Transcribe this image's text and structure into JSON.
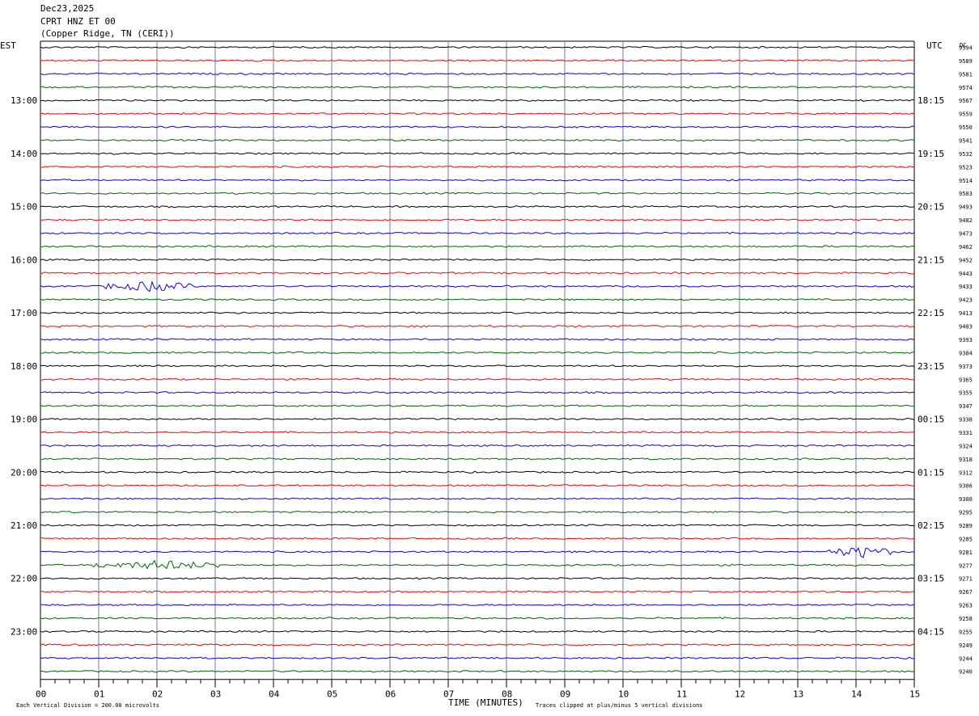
{
  "header": {
    "date": "Dec23,2025",
    "station": "CPRT HNZ ET 00",
    "location": "(Copper Ridge, TN (CERI))"
  },
  "left_tz": "EST",
  "right_tz": "UTC",
  "dc_label": "DC",
  "footer": {
    "scale": "Each Vertical Division =  200.00 microvolts",
    "clip": "Traces clipped at plus/minus 5 vertical divisions"
  },
  "colors": {
    "trace": [
      "#000000",
      "#ff0000",
      "#0000ff",
      "#006400"
    ],
    "grid": "#7a7ab0"
  },
  "chart_data": {
    "type": "line",
    "title": "CPRT HNZ ET 00",
    "xlabel": "TIME (MINUTES)",
    "ylabel": "",
    "xlim": [
      0,
      15
    ],
    "x_ticks": [
      "00",
      "01",
      "02",
      "03",
      "04",
      "05",
      "06",
      "07",
      "08",
      "09",
      "10",
      "11",
      "12",
      "13",
      "14",
      "15"
    ],
    "left_hour_labels": [
      "13:00",
      "14:00",
      "15:00",
      "16:00",
      "17:00",
      "18:00",
      "19:00",
      "20:00",
      "21:00",
      "22:00",
      "23:00"
    ],
    "right_hour_labels": [
      "18:15",
      "19:15",
      "20:15",
      "21:15",
      "22:15",
      "23:15",
      "00:15",
      "01:15",
      "02:15",
      "03:15",
      "04:15"
    ],
    "dc_offsets": [
      "9594",
      "9589",
      "9581",
      "9574",
      "9567",
      "9559",
      "9550",
      "9541",
      "9532",
      "9523",
      "9514",
      "9503",
      "9493",
      "9482",
      "9473",
      "9462",
      "9452",
      "9443",
      "9433",
      "9423",
      "9413",
      "9403",
      "9393",
      "9384",
      "9373",
      "9365",
      "9355",
      "9347",
      "9338",
      "9331",
      "9324",
      "9318",
      "9312",
      "9306",
      "9300",
      "9295",
      "9289",
      "9285",
      "9281",
      "9277",
      "9271",
      "9267",
      "9263",
      "9258",
      "9255",
      "9249",
      "9244",
      "9240"
    ],
    "events": [
      {
        "trace": 18,
        "start_min": 1.1,
        "end_min": 2.6,
        "peak_min": 1.9
      },
      {
        "trace": 39,
        "start_min": 0.9,
        "end_min": 3.2,
        "peak_min": 2.1
      },
      {
        "trace": 38,
        "start_min": 13.5,
        "end_min": 14.6,
        "peak_min": 14.1
      }
    ]
  }
}
